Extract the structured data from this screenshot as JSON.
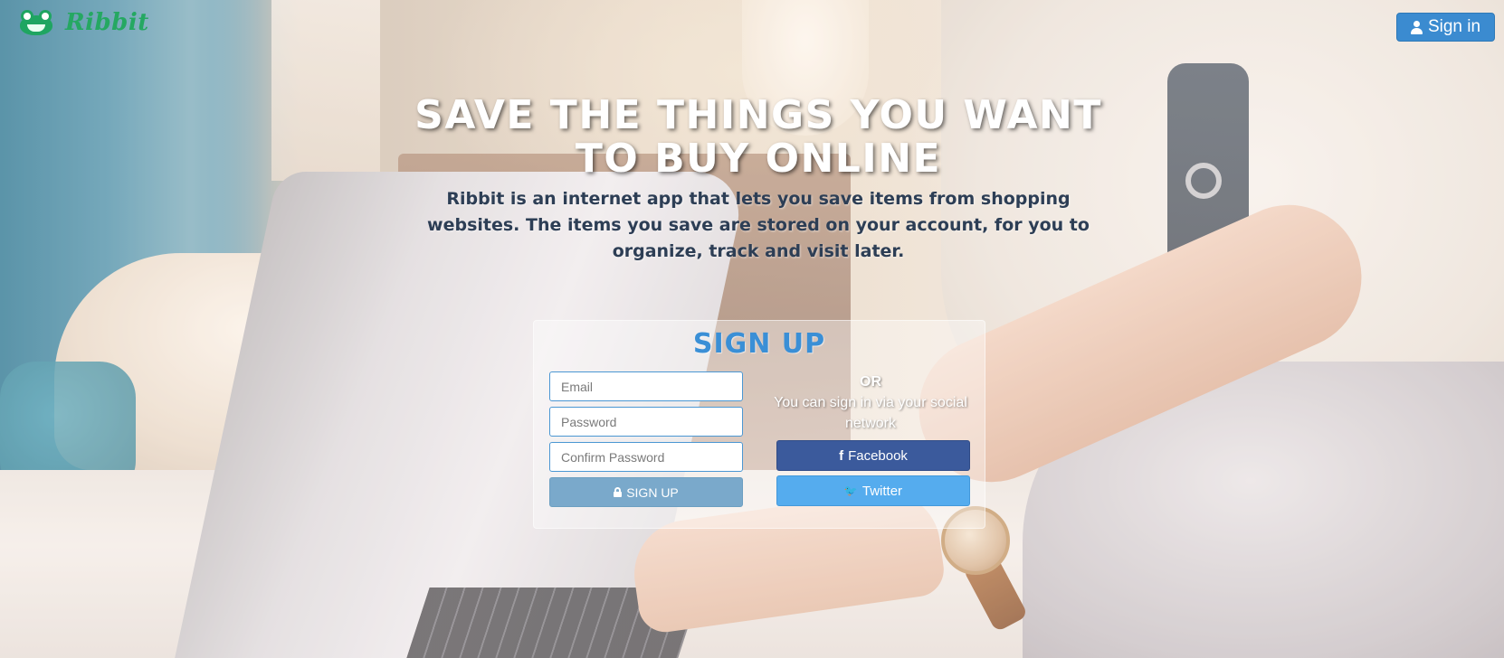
{
  "app": {
    "logo_text": "Ribbit"
  },
  "header": {
    "signin_label": "Sign in"
  },
  "hero": {
    "title": "SAVE THE THINGS YOU WANT TO BUY ONLINE",
    "description": "Ribbit is an internet app that lets you save items from shopping websites. The items you save are stored on your account, for you to organize, track and visit later."
  },
  "signup": {
    "title": "SIGN UP",
    "email_placeholder": "Email",
    "password_placeholder": "Password",
    "confirm_placeholder": "Confirm Password",
    "submit_label": "SIGN UP",
    "or_label": "OR",
    "social_text": "You can sign in via your social network",
    "facebook_label": "Facebook",
    "twitter_label": "Twitter"
  },
  "icons": {
    "logo": "frog-icon",
    "signin": "user-icon",
    "submit": "lock-icon",
    "facebook": "facebook-icon",
    "twitter": "twitter-icon"
  },
  "colors": {
    "brand_green": "#25a862",
    "primary_blue": "#3b8bd0",
    "signup_title": "#3a8fd6",
    "facebook": "#3b5a9c",
    "twitter": "#55acee"
  }
}
